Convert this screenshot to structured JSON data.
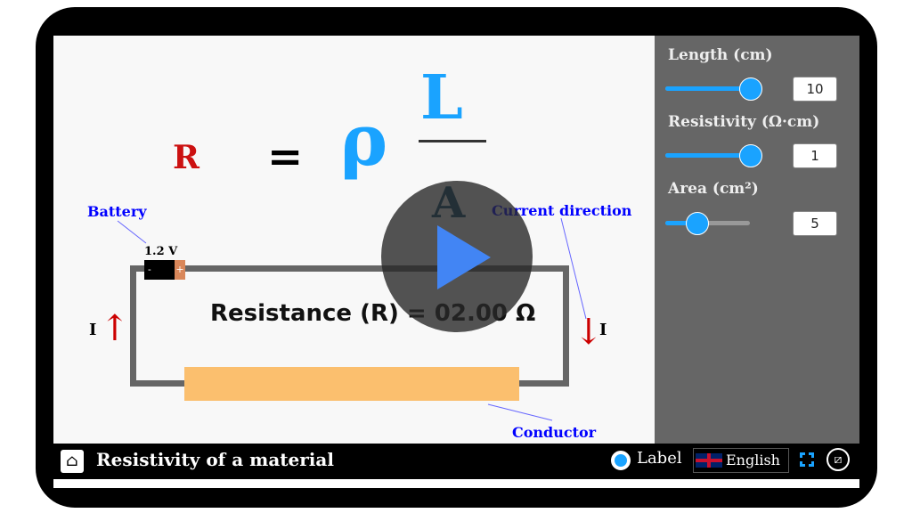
{
  "formula": {
    "lhs": "R",
    "eq": "=",
    "rho": "ρ",
    "numerator": "L",
    "denominator": "A"
  },
  "labels": {
    "battery": "Battery",
    "voltage": "1.2 V",
    "battery_neg": "-",
    "battery_pos": "+",
    "current_direction": "Current direction",
    "conductor": "Conductor",
    "current_left": "I",
    "current_right": "I"
  },
  "result": "Resistance (R) = 02.00 Ω",
  "controls": [
    {
      "label": "Length (cm)",
      "value": "10",
      "fraction": 1.0
    },
    {
      "label": "Resistivity (Ω·cm)",
      "value": "1",
      "fraction": 1.0
    },
    {
      "label": "Area (cm²)",
      "value": "5",
      "fraction": 0.37
    }
  ],
  "bottom_bar": {
    "title": "Resistivity of a material",
    "label_toggle": "Label",
    "language": "English"
  },
  "colors": {
    "accent": "#1aa3ff",
    "resistor": "#fbbf6e",
    "current_arrow": "#cc0000",
    "label": "#0000ff"
  }
}
